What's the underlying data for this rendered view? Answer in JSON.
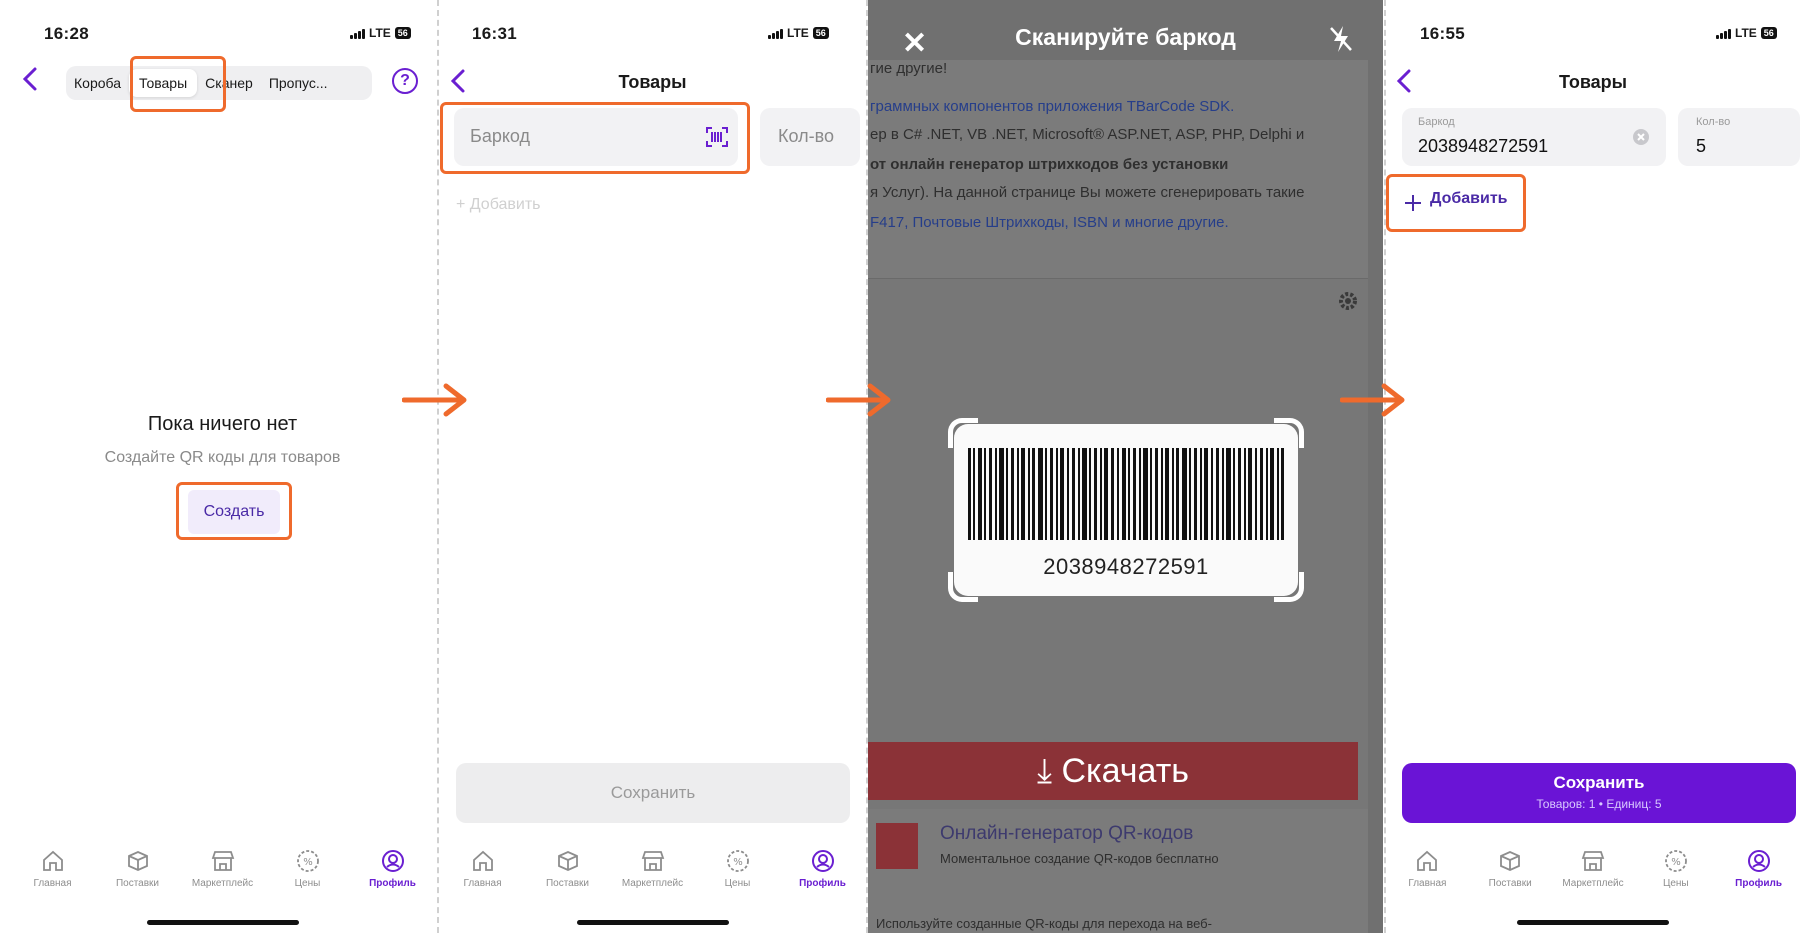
{
  "screen1": {
    "time": "16:28",
    "network": "LTE",
    "battery": "56",
    "segments": [
      "Короба",
      "Товары",
      "Сканер",
      "Пропус..."
    ],
    "help_icon": "question-circle-icon",
    "empty_title": "Пока ничего нет",
    "empty_subtitle": "Создайте QR коды для товаров",
    "create_label": "Создать"
  },
  "screen2": {
    "time": "16:31",
    "network": "LTE",
    "battery": "56",
    "title": "Товары",
    "barcode_placeholder": "Баркод",
    "qty_placeholder": "Кол-во",
    "add_label": "+ Добавить",
    "save_label": "Сохранить"
  },
  "screen3": {
    "title": "Сканируйте баркод",
    "bg_lines": [
      "гие другие!",
      "граммных компонентов  приложения TBarCode SDK.",
      "ер в C# .NET, VB .NET, Microsoft® ASP.NET, ASP, PHP, Delphi и",
      "от онлайн генератор штрихкодов без установки",
      "я Услуг). На данной странице Вы можете сгенерировать такие",
      "F417, Почтовые Штрихкоды, ISBN и многие другие."
    ],
    "download_label": "⤓ Скачать",
    "barcode_digits": "2038948272591",
    "qr_promo_title": "Онлайн-генератор QR-кодов",
    "qr_promo_sub": "Моментальное создание QR-кодов бесплатно",
    "foot_text": "Используйте созданные QR-коды для перехода на веб-"
  },
  "screen4": {
    "time": "16:55",
    "network": "LTE",
    "battery": "56",
    "title": "Товары",
    "barcode_label": "Баркод",
    "barcode_value": "2038948272591",
    "qty_label": "Кол-во",
    "qty_value": "5",
    "add_label": "Добавить",
    "save_label": "Сохранить",
    "save_sub": "Товаров: 1 • Единиц: 5"
  },
  "tabbar": {
    "items": [
      {
        "label": "Главная",
        "icon": "home-icon"
      },
      {
        "label": "Поставки",
        "icon": "box-icon"
      },
      {
        "label": "Маркетплейс",
        "icon": "store-icon"
      },
      {
        "label": "Цены",
        "icon": "percent-badge-icon"
      },
      {
        "label": "Профиль",
        "icon": "profile-icon"
      }
    ]
  },
  "colors": {
    "accent": "#6a14d6",
    "highlight": "#ef6a2c"
  }
}
